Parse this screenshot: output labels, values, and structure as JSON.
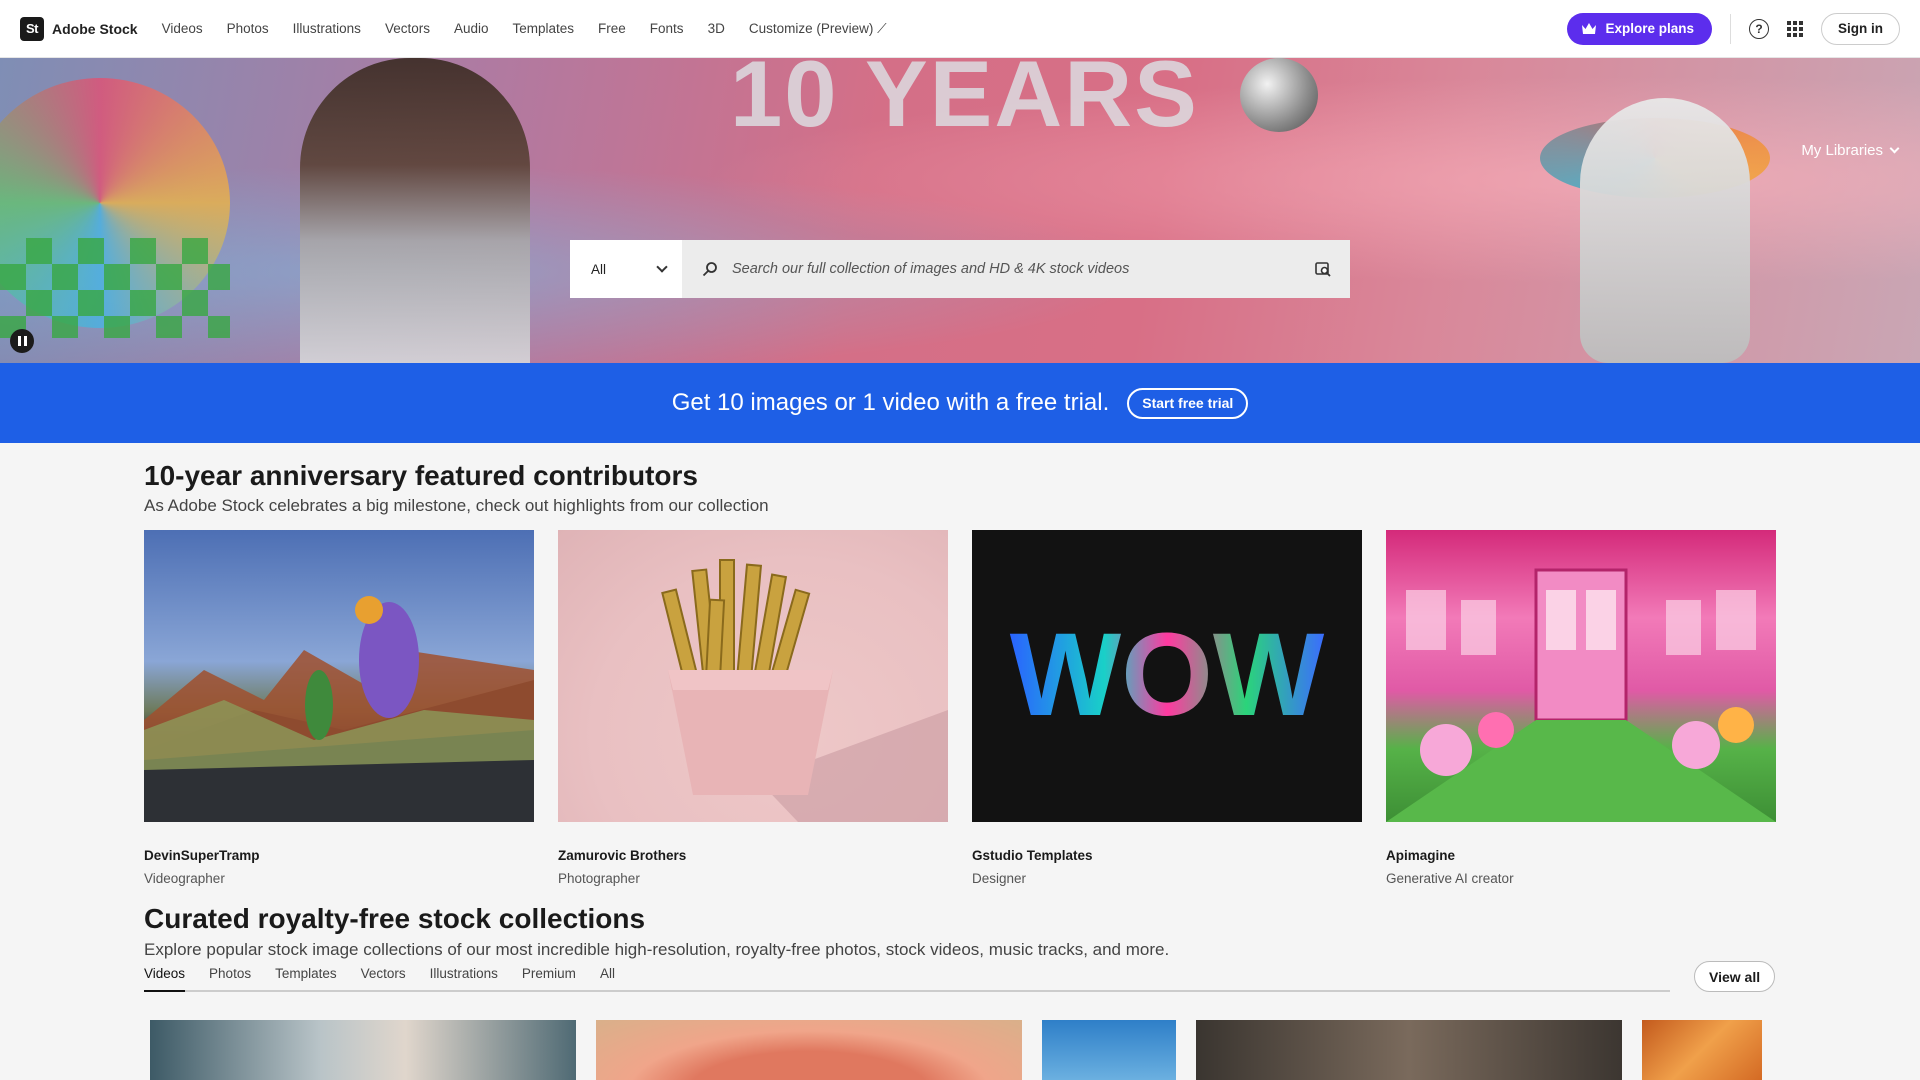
{
  "brand": {
    "logo": "St",
    "name": "Adobe Stock"
  },
  "nav": {
    "links": [
      "Videos",
      "Photos",
      "Illustrations",
      "Vectors",
      "Audio",
      "Templates",
      "Free",
      "Fonts",
      "3D",
      "Customize (Preview)"
    ],
    "explore_label": "Explore plans",
    "signin_label": "Sign in",
    "accent": "#5c2ded"
  },
  "hero": {
    "title": "10 YEARS",
    "my_libraries": "My Libraries",
    "search_scope": "All",
    "search_placeholder": "Search our full collection of images and HD & 4K stock videos"
  },
  "promo": {
    "text": "Get 10 images or 1 video with a free trial.",
    "button": "Start free trial",
    "color": "#1e5fe6"
  },
  "featured": {
    "title": "10-year anniversary featured contributors",
    "subtitle": "As Adobe Stock celebrates a big milestone, check out highlights from our collection",
    "items": [
      {
        "name": "DevinSuperTramp",
        "role": "Videographer"
      },
      {
        "name": "Zamurovic Brothers",
        "role": "Photographer"
      },
      {
        "name": "Gstudio Templates",
        "role": "Designer"
      },
      {
        "name": "Apimagine",
        "role": "Generative AI creator"
      }
    ],
    "wow_text": "WOW"
  },
  "collections": {
    "title": "Curated royalty-free stock collections",
    "subtitle": "Explore popular stock image collections of our most incredible high-resolution, royalty-free photos, stock videos, music tracks, and more.",
    "tabs": [
      "Videos",
      "Photos",
      "Templates",
      "Vectors",
      "Illustrations",
      "Premium",
      "All"
    ],
    "active_tab": "Videos",
    "view_all": "View all"
  }
}
